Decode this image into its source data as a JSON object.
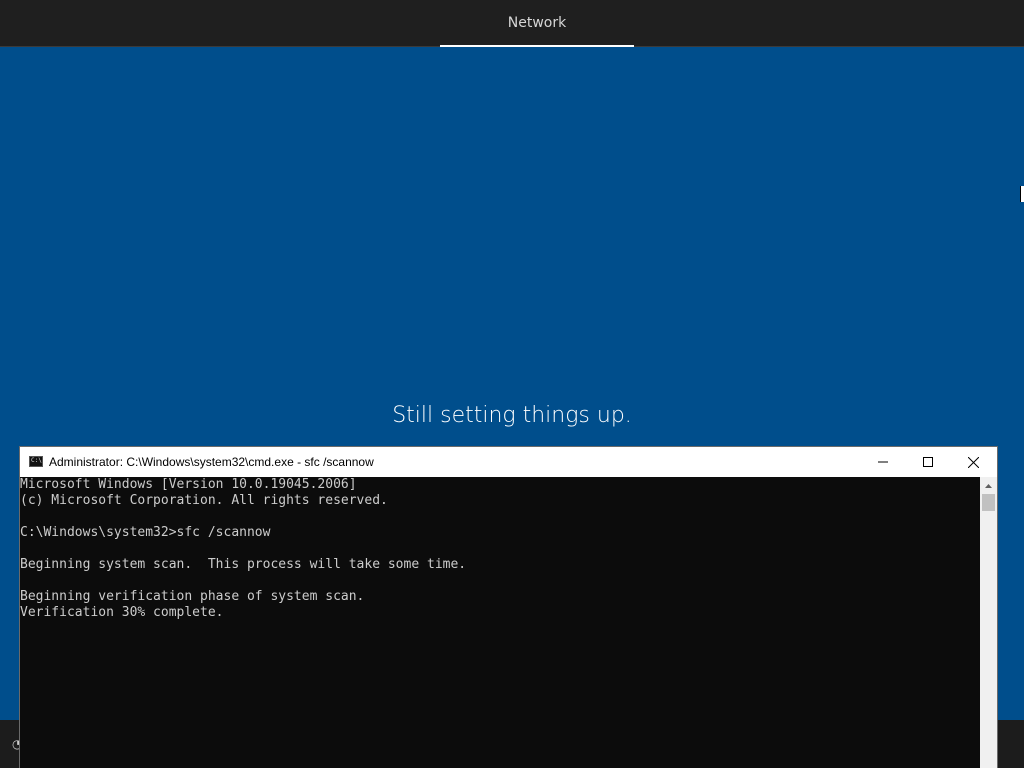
{
  "header": {
    "tab_label": "Network"
  },
  "status": {
    "message": "Still setting things up."
  },
  "cmd": {
    "title": "Administrator: C:\\Windows\\system32\\cmd.exe - sfc  /scannow",
    "icon_text": "C:\\",
    "lines": [
      "Microsoft Windows [Version 10.0.19045.2006]",
      "(c) Microsoft Corporation. All rights reserved.",
      "",
      "C:\\Windows\\system32>sfc /scannow",
      "",
      "Beginning system scan.  This process will take some time.",
      "",
      "Beginning verification phase of system scan.",
      "Verification 30% complete."
    ]
  },
  "icons": {
    "app": "cmd-app-icon",
    "minimize": "minimize-icon",
    "maximize": "maximize-icon",
    "close": "close-icon",
    "scroll_up": "scroll-up-icon",
    "ease_of_access": "ease-of-access-icon"
  },
  "colors": {
    "background": "#004e8c",
    "topbar": "#1f1f1f",
    "console_bg": "#0c0c0c",
    "console_text": "#cccccc"
  }
}
